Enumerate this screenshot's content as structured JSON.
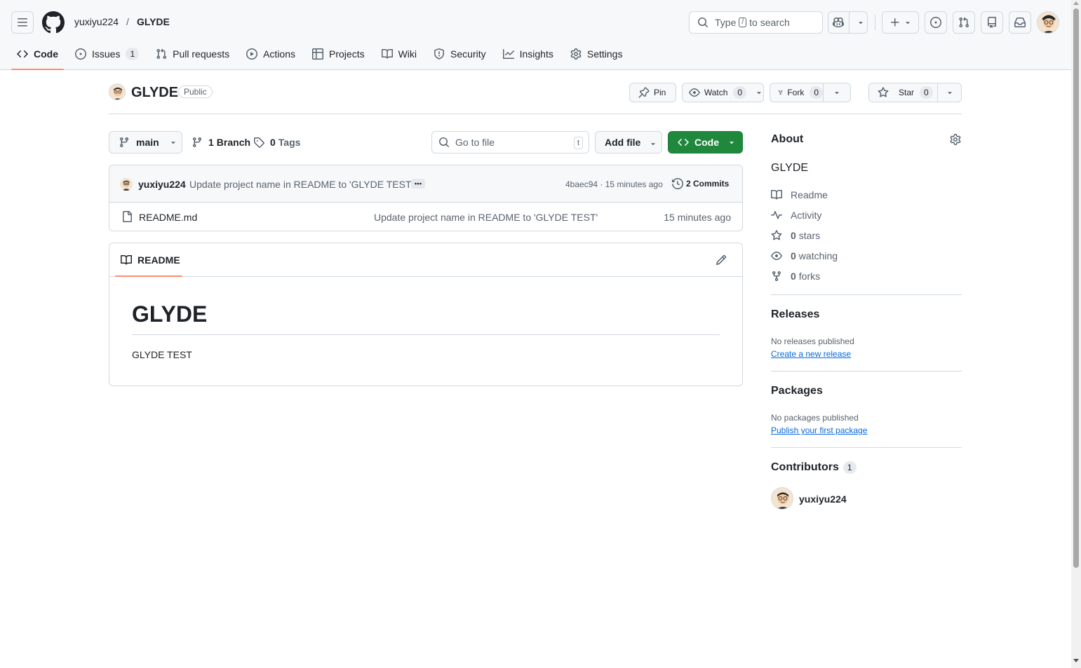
{
  "header": {
    "owner": "yuxiyu224",
    "separator": "/",
    "repo": "GLYDE",
    "search_prefix": "Type",
    "search_key": "/",
    "search_suffix": "to search"
  },
  "tabs": [
    {
      "label": "Code",
      "icon": "code-icon",
      "selected": true
    },
    {
      "label": "Issues",
      "icon": "issue-icon",
      "count": "1"
    },
    {
      "label": "Pull requests",
      "icon": "pull-request-icon"
    },
    {
      "label": "Actions",
      "icon": "play-icon"
    },
    {
      "label": "Projects",
      "icon": "table-icon"
    },
    {
      "label": "Wiki",
      "icon": "book-icon"
    },
    {
      "label": "Security",
      "icon": "shield-icon"
    },
    {
      "label": "Insights",
      "icon": "graph-icon"
    },
    {
      "label": "Settings",
      "icon": "gear-icon"
    }
  ],
  "repo_head": {
    "name": "GLYDE",
    "visibility": "Public",
    "pin_label": "Pin",
    "watch_label": "Watch",
    "watch_count": "0",
    "fork_label": "Fork",
    "fork_count": "0",
    "star_label": "Star",
    "star_count": "0"
  },
  "file_nav": {
    "branch": "main",
    "branch_count": "1",
    "branch_label": "Branch",
    "tag_count": "0",
    "tag_label": "Tags",
    "goto_placeholder": "Go to file",
    "goto_key": "t",
    "add_file_label": "Add file",
    "code_label": "Code"
  },
  "latest_commit": {
    "author": "yuxiyu224",
    "message": "Update project name in README to 'GLYDE TEST'",
    "hash_time": "4baec94 · 15 minutes ago",
    "commits_label": "2 Commits"
  },
  "files": [
    {
      "name": "README.md",
      "commit": "Update project name in README to 'GLYDE TEST'",
      "age": "15 minutes ago"
    }
  ],
  "readme": {
    "tab_label": "README",
    "h1": "GLYDE",
    "body": "GLYDE TEST"
  },
  "sidebar": {
    "about_title": "About",
    "description": "GLYDE",
    "readme_label": "Readme",
    "activity_label": "Activity",
    "stars_count": "0",
    "stars_label": "stars",
    "watching_count": "0",
    "watching_label": "watching",
    "forks_count": "0",
    "forks_label": "forks",
    "releases_title": "Releases",
    "releases_empty": "No releases published",
    "releases_link": "Create a new release",
    "packages_title": "Packages",
    "packages_empty": "No packages published",
    "packages_link": "Publish your first package",
    "contributors_title": "Contributors",
    "contributors_count": "1",
    "contributor_name": "yuxiyu224"
  },
  "colors": {
    "accent_underline": "#fd8c73",
    "primary_button": "#1f883d",
    "link": "#0969da",
    "border": "#d1d9e0",
    "muted_text": "#59636e"
  }
}
